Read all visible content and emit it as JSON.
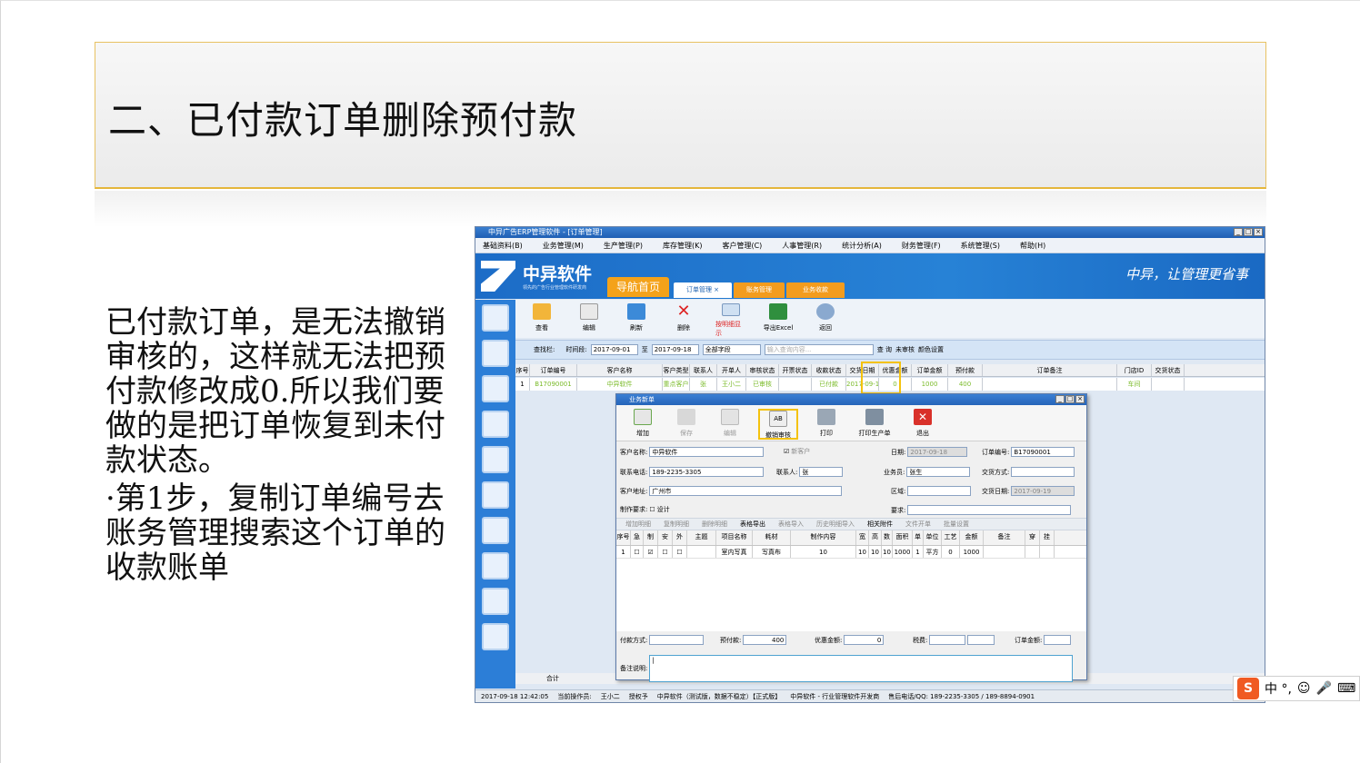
{
  "slide": {
    "title": "二、已付款订单删除预付款",
    "para1": "已付款订单，是无法撤销审核的，这样就无法把预付款修改成0.所以我们要做的是把订单恢复到未付款状态。",
    "para2": "·第1步，复制订单编号去账务管理搜索这个订单的收款账单"
  },
  "app": {
    "title": "中异广告ERP管理软件 - [订单管理]",
    "menu": [
      "基础资料(B)",
      "业务管理(M)",
      "生产管理(P)",
      "库存管理(K)",
      "客户管理(C)",
      "人事管理(R)",
      "统计分析(A)",
      "财务管理(F)",
      "系统管理(S)",
      "帮助(H)"
    ],
    "logo": "中异软件",
    "logo_sub": "领先的广告行业管理软件研发商",
    "nav_home": "导航首页",
    "tabs": [
      "订单管理 ×",
      "账务管理",
      "业务收款"
    ],
    "slogan": "中异，让管理更省事",
    "toolbar": [
      "查看",
      "编辑",
      "刷新",
      "删除",
      "按明细显示",
      "导出Excel",
      "返回"
    ],
    "filter": {
      "label": "查找栏:",
      "time": "时间段:",
      "from": "2017-09-01",
      "to_label": "至",
      "to": "2017-09-18",
      "field": "全部字段",
      "placeholder": "输入查询内容...",
      "search": "查 询",
      "unaudit": "未审核",
      "color": "颜色设置"
    },
    "grid_head": [
      "序号",
      "订单编号",
      "客户名称",
      "客户类型",
      "联系人",
      "开单人",
      "审核状态",
      "开票状态",
      "收款状态",
      "交货日期",
      "优惠金额",
      "订单金额",
      "预付款",
      "订单备注",
      "门店ID",
      "交货状态"
    ],
    "grid_row": [
      "1",
      "B17090001",
      "中异软件",
      "重点客户",
      "张",
      "王小二",
      "已审核",
      "",
      "已付款",
      "2017-09-1",
      "0",
      "1000",
      "400",
      "",
      "车间",
      ""
    ],
    "total_label": "合计",
    "status": [
      "2017-09-18 12:42:05",
      "当前操作员:",
      "王小二",
      "授权予",
      "中异软件（测试版，数据不稳定）【正式版】",
      "中异软件 - 行业管理软件开发商",
      "售后电话/QQ: 189-2235-3305 / 189-8894-0901"
    ]
  },
  "dialog": {
    "title": "业务新单",
    "tools": [
      "增加",
      "保存",
      "编辑",
      "撤销审核",
      "打印",
      "打印生产单",
      "退出"
    ],
    "form": {
      "customer_label": "客户名称:",
      "customer": "中异软件",
      "new_customer": "新客户",
      "date_label": "日期:",
      "date": "2017-09-18",
      "order_label": "订单编号:",
      "order": "B17090001",
      "phone_label": "联系电话:",
      "phone": "189-2235-3305",
      "contact_label": "联系人:",
      "contact": "张",
      "sales_label": "业务员:",
      "sales": "张生",
      "delivery_label": "交货方式:",
      "address_label": "客户地址:",
      "address": "广州市",
      "area_label": "区域:",
      "due_label": "交货日期:",
      "due": "2017-09-19",
      "req_label": "制作要求:",
      "design": "设计",
      "demand_label": "要求:"
    },
    "subtabs": [
      "增加明细",
      "复制明细",
      "删除明细",
      "表格导出",
      "表格导入",
      "历史明细导入",
      "相关附件",
      "文件开单",
      "批量设置"
    ],
    "line_head": [
      "序号",
      "急",
      "制",
      "安",
      "外",
      "主题",
      "项目名称",
      "耗材",
      "制作内容",
      "宽",
      "高",
      "数",
      "面积",
      "单",
      "单位",
      "工艺",
      "金额",
      "备注",
      "穿",
      "挂"
    ],
    "line_row": [
      "1",
      "",
      "",
      "",
      "",
      "",
      "室内写真",
      "写真布",
      "10",
      "10",
      "10",
      "10",
      "1000",
      "1",
      "平方",
      "0",
      "1000",
      "",
      "",
      ""
    ],
    "foot": {
      "pay_label": "付款方式:",
      "prepay_label": "预付款:",
      "prepay": "400",
      "discount_label": "优惠金额:",
      "discount": "0",
      "tax_label": "税费:",
      "amount_label": "订单金额:",
      "memo_label": "备注说明:"
    }
  },
  "ime": {
    "logo": "S",
    "text": "中 °,"
  }
}
